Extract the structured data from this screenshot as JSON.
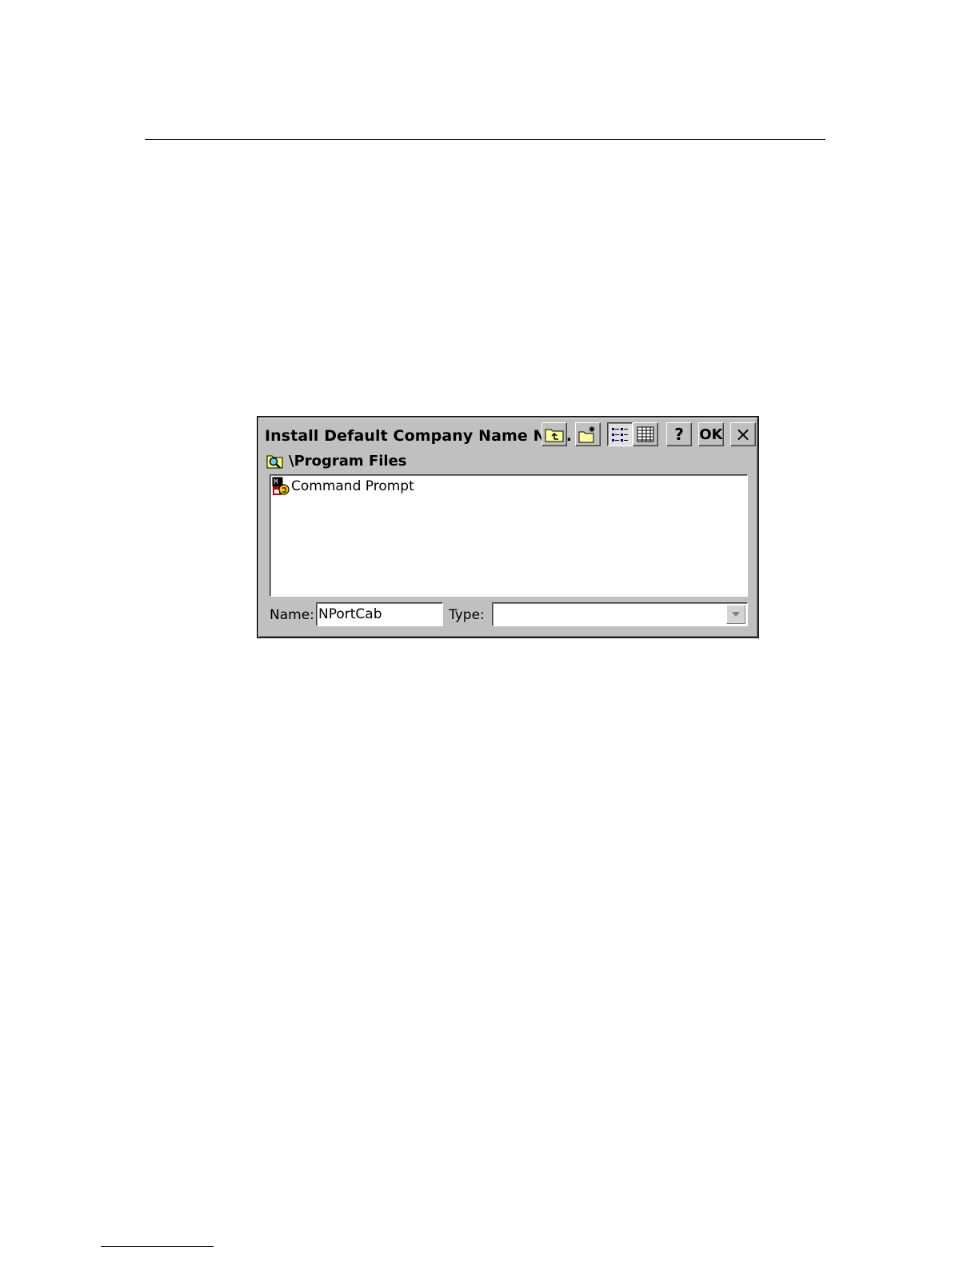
{
  "dialog": {
    "title": "Install Default Company Name NP...",
    "toolbar": {
      "up_folder_icon": "up-folder-icon",
      "new_folder_icon": "new-folder-icon",
      "list_view_icon": "list-view-icon",
      "details_view_icon": "details-view-icon",
      "help_label": "?",
      "ok_label": "OK",
      "close_label": "×"
    },
    "path": "\\Program Files",
    "files": [
      {
        "label": "Command Prompt",
        "icon": "command-prompt-icon"
      }
    ],
    "name_label": "Name:",
    "name_value": "NPortCab",
    "type_label": "Type:",
    "type_value": ""
  }
}
